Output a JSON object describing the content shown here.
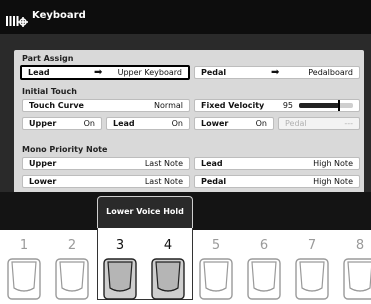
{
  "title": "Keyboard",
  "part_assign": {
    "heading": "Part Assign",
    "lead": {
      "label": "Lead",
      "arrow": "➡",
      "value": "Upper Keyboard"
    },
    "pedal": {
      "label": "Pedal",
      "arrow": "➡",
      "value": "Pedalboard"
    }
  },
  "initial_touch": {
    "heading": "Initial Touch",
    "touch_curve": {
      "label": "Touch Curve",
      "value": "Normal"
    },
    "fixed_velocity": {
      "label": "Fixed Velocity",
      "value": "95",
      "level": 95,
      "max": 127
    },
    "upper": {
      "label": "Upper",
      "value": "On"
    },
    "lead": {
      "label": "Lead",
      "value": "On"
    },
    "lower": {
      "label": "Lower",
      "value": "On"
    },
    "pedal": {
      "label": "Pedal",
      "value": "---"
    }
  },
  "mono_priority": {
    "heading": "Mono Priority Note",
    "upper": {
      "label": "Upper",
      "value": "Last Note"
    },
    "lower": {
      "label": "Lower",
      "value": "Last Note"
    },
    "lead": {
      "label": "Lead",
      "value": "High Note"
    },
    "pedal": {
      "label": "Pedal",
      "value": "High Note"
    }
  },
  "lower_voice_hold": "Lower Voice Hold",
  "pedal_numbers": [
    "1",
    "2",
    "3",
    "4",
    "5",
    "6",
    "7",
    "8"
  ],
  "active_pedals": [
    "3",
    "4"
  ]
}
